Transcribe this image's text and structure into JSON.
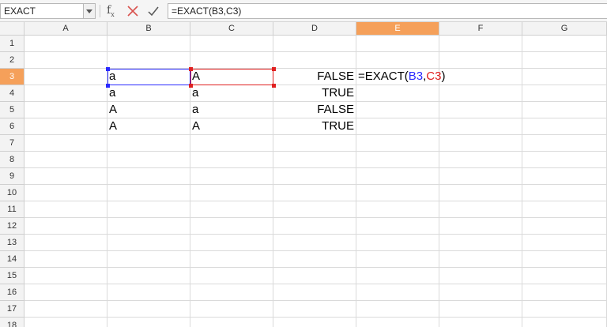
{
  "toolbar": {
    "name_box": "EXACT",
    "formula": "=EXACT(B3,C3)",
    "icons": [
      "chevron-down-icon",
      "function-wizard-icon",
      "cancel-icon",
      "accept-icon"
    ]
  },
  "columns": [
    "A",
    "B",
    "C",
    "D",
    "E",
    "F",
    "G"
  ],
  "active_column": "E",
  "rows": [
    "1",
    "2",
    "3",
    "4",
    "5",
    "6",
    "7",
    "8",
    "9",
    "10",
    "11",
    "12",
    "13",
    "14",
    "15",
    "16",
    "17",
    "18"
  ],
  "active_row": "3",
  "cells": {
    "B3": "a",
    "C3": "A",
    "D3": "FALSE",
    "B4": "a",
    "C4": "a",
    "D4": "TRUE",
    "B5": "A",
    "C5": "a",
    "D5": "FALSE",
    "B6": "A",
    "C6": "A",
    "D6": "TRUE"
  },
  "editing_cell": {
    "ref": "E3",
    "prefix": "=EXACT(",
    "arg1": "B3",
    "comma": ",",
    "arg2": "C3",
    "suffix": ")"
  },
  "colors": {
    "active_header": "#f5a05a",
    "ref_b": "#2a2aff",
    "ref_c": "#e02020"
  }
}
